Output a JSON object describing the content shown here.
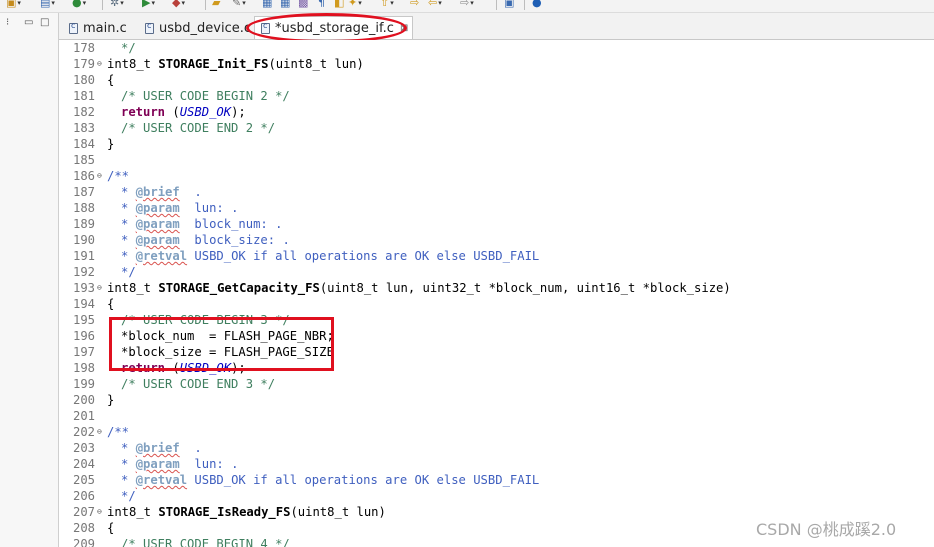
{
  "toolbar": {
    "icons": [
      "new-icon",
      "source-file-icon",
      "refresh-icon",
      "build-icon",
      "debug-icon",
      "run-icon",
      "stop-icon",
      "open-folder-icon",
      "search-icon",
      "navigate-icon",
      "forward-icon",
      "back-icon",
      "next-edit-icon",
      "open-perspective-icon",
      "info-icon"
    ]
  },
  "tabs": [
    {
      "label": "main.c",
      "active": false
    },
    {
      "label": "usbd_device.c",
      "active": false
    },
    {
      "label": "*usbd_storage_if.c",
      "active": true,
      "close": "⊠"
    }
  ],
  "editor": {
    "line_numbers": [
      "178",
      "179",
      "180",
      "181",
      "182",
      "183",
      "184",
      "185",
      "186",
      "187",
      "188",
      "189",
      "190",
      "191",
      "192",
      "193",
      "194",
      "195",
      "196",
      "197",
      "198",
      "199",
      "200",
      "201",
      "202",
      "203",
      "204",
      "205",
      "206",
      "207",
      "208",
      "209"
    ],
    "lines": {
      "l178": "*/",
      "l179": {
        "type": "int8_t",
        "name": "STORAGE_Init_FS",
        "params": "(uint8_t lun)"
      },
      "l180": "{",
      "l181": "/* USER CODE BEGIN 2 */",
      "l182": {
        "kw": "return",
        "pre": " (",
        "macro": "USBD_OK",
        "post": ");"
      },
      "l183": "/* USER CODE END 2 */",
      "l184": "}",
      "l185": "",
      "l186": "/**",
      "l187": {
        "star": "* ",
        "tag": "@brief",
        "text": "  ."
      },
      "l188": {
        "star": "* ",
        "tag": "@param",
        "text": "  lun: ."
      },
      "l189": {
        "star": "* ",
        "tag": "@param",
        "text": "  block_num: ."
      },
      "l190": {
        "star": "* ",
        "tag": "@param",
        "text": "  block_size: ."
      },
      "l191": {
        "star": "* ",
        "tag": "@retval",
        "text": " USBD_OK if all operations are OK else USBD_FAIL"
      },
      "l192": "*/",
      "l193": {
        "type": "int8_t",
        "name": "STORAGE_GetCapacity_FS",
        "params": "(uint8_t lun, uint32_t *block_num, uint16_t *block_size)"
      },
      "l194": "{",
      "l195": "/* USER CODE BEGIN 3 */",
      "l196": "*block_num  = FLASH_PAGE_NBR;",
      "l197": "*block_size = FLASH_PAGE_SIZE",
      "l198": {
        "kw": "return",
        "pre": " (",
        "macro": "USBD_OK",
        "post": ");"
      },
      "l199": "/* USER CODE END 3 */",
      "l200": "}",
      "l201": "",
      "l202": "/**",
      "l203": {
        "star": "* ",
        "tag": "@brief",
        "text": "  ."
      },
      "l204": {
        "star": "* ",
        "tag": "@param",
        "text": "  lun: ."
      },
      "l205": {
        "star": "* ",
        "tag": "@retval",
        "text": " USBD_OK if all operations are OK else USBD_FAIL"
      },
      "l206": "*/",
      "l207": {
        "type": "int8_t",
        "name": "STORAGE_IsReady_FS",
        "params": "(uint8_t lun)"
      },
      "l208": "{",
      "l209": "/* USER CODE BEGIN 4 */"
    },
    "fold_marker": "⊖"
  },
  "annotations": {
    "color": "#e0101f"
  },
  "watermark": "CSDN @桃成蹊2.0"
}
